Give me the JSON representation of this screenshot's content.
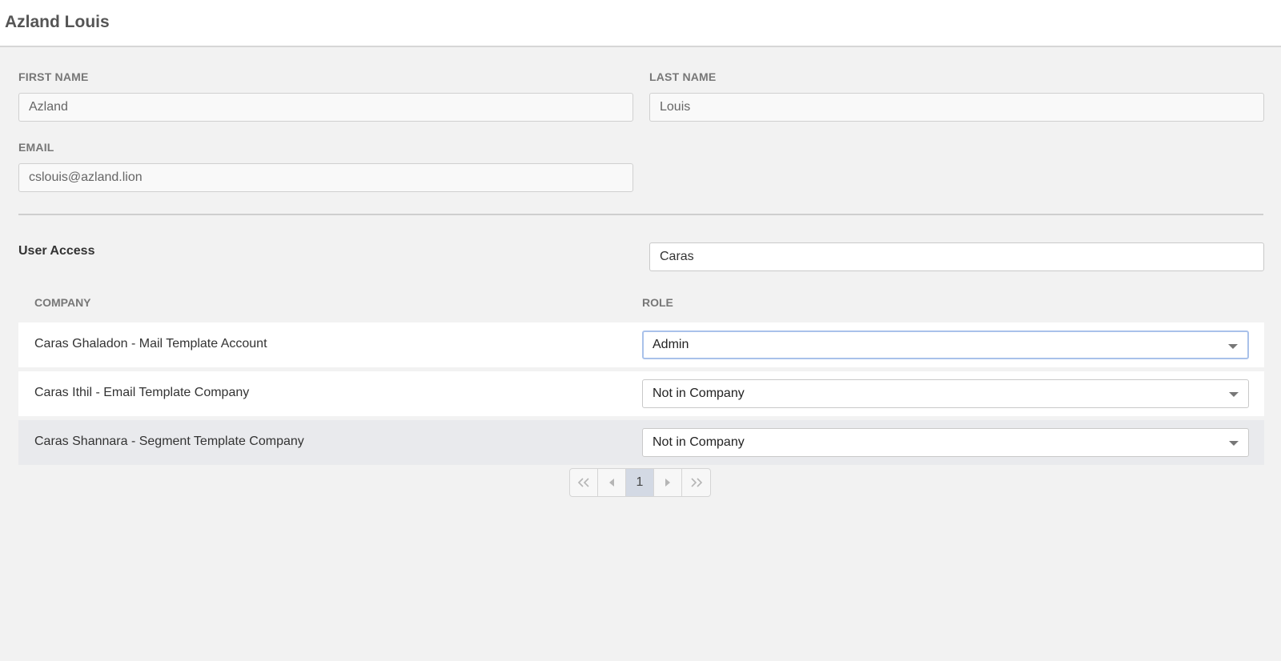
{
  "header": {
    "title": "Azland Louis"
  },
  "form": {
    "first_name": {
      "label": "FIRST NAME",
      "value": "Azland"
    },
    "last_name": {
      "label": "LAST NAME",
      "value": "Louis"
    },
    "email": {
      "label": "EMAIL",
      "value": "cslouis@azland.lion"
    }
  },
  "access": {
    "title": "User Access",
    "search_value": "Caras",
    "columns": {
      "company": "COMPANY",
      "role": "ROLE"
    },
    "rows": [
      {
        "company": "Caras Ghaladon - Mail Template Account",
        "role": "Admin"
      },
      {
        "company": "Caras Ithil - Email Template Company",
        "role": "Not in Company"
      },
      {
        "company": "Caras Shannara - Segment Template Company",
        "role": "Not in Company"
      }
    ]
  },
  "pagination": {
    "current_page": "1",
    "icons": [
      "first-page-icon",
      "prev-page-icon",
      "next-page-icon",
      "last-page-icon"
    ]
  },
  "colors": {
    "background": "#f2f2f2",
    "focus_border": "#a9c1ea",
    "active_page": "#d3d9e4",
    "highlight_row": "#e9eaed"
  }
}
